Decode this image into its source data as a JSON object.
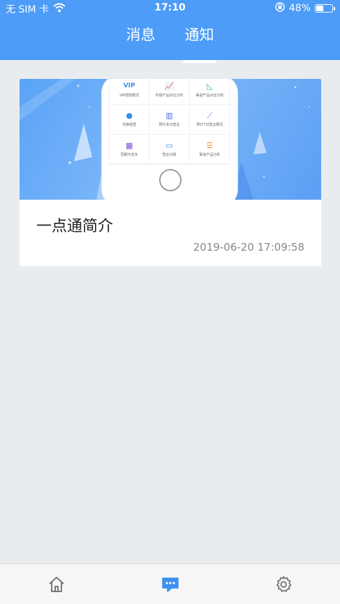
{
  "status_bar": {
    "carrier": "无 SIM 卡",
    "time": "17:10",
    "battery_percent": "48%",
    "battery_level": 0.48,
    "icons": [
      "wifi-icon",
      "orientation-lock-icon",
      "battery-icon"
    ]
  },
  "header": {
    "tabs": [
      {
        "label": "消息",
        "active": false
      },
      {
        "label": "通知",
        "active": true
      }
    ],
    "accent_color": "#4c9cf8"
  },
  "notices": [
    {
      "title": "一点通简介",
      "time": "2019-06-20 17:09:58",
      "banner": {
        "grid_items": [
          {
            "icon": "vip-icon",
            "label": "VIP现款概况"
          },
          {
            "icon": "trend-chart-icon",
            "label": "市场产品对比分析"
          },
          {
            "icon": "area-chart-icon",
            "label": "渠道产品对比分析"
          },
          {
            "icon": "dot-icon",
            "label": "月度经营"
          },
          {
            "icon": "bar-chart-icon",
            "label": "预计本日营业"
          },
          {
            "icon": "line-chart-icon",
            "label": "预计7日营业概况"
          },
          {
            "icon": "table-icon",
            "label": "同期与去年"
          },
          {
            "icon": "box-icon",
            "label": "营业日报"
          },
          {
            "icon": "list-chart-icon",
            "label": "渠道产品分析"
          }
        ]
      }
    }
  ],
  "bottom_nav": [
    {
      "icon": "home-icon",
      "active": false
    },
    {
      "icon": "message-icon",
      "active": true
    },
    {
      "icon": "settings-icon",
      "active": false
    }
  ]
}
